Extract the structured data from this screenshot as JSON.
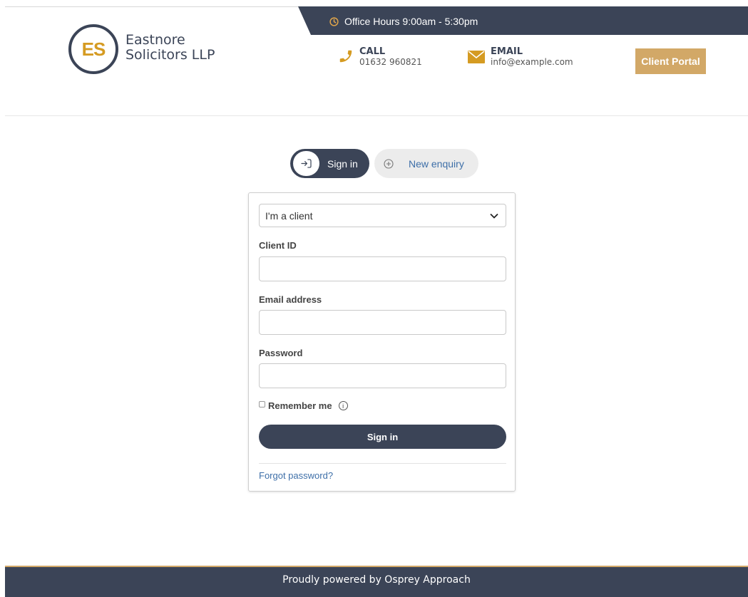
{
  "header": {
    "office_hours": "Office Hours 9:00am - 5:30pm",
    "logo_initials": "ES",
    "logo_name_line1": "Eastnore",
    "logo_name_line2": "Solicitors LLP",
    "call_label": "CALL",
    "call_value": "01632 960821",
    "email_label": "EMAIL",
    "email_value": "info@example.com",
    "portal_button": "Client Portal",
    "icons": [
      "clock-icon",
      "phone-icon",
      "envelope-icon"
    ]
  },
  "tabs": [
    {
      "label": "Sign in",
      "icon": "sign-in-icon",
      "active": true
    },
    {
      "label": "New enquiry",
      "icon": "plus-circle-icon",
      "active": false
    }
  ],
  "form": {
    "account_type": "I'm a client",
    "client_id_label": "Client ID",
    "client_id_value": "",
    "email_label": "Email address",
    "email_value": "",
    "password_label": "Password",
    "password_value": "",
    "remember_label": "Remember me",
    "remember_checked": false,
    "submit_label": "Sign in",
    "forgot_label": "Forgot password?"
  },
  "footer": {
    "text": "Proudly powered by Osprey Approach"
  },
  "colors": {
    "navy": "#3b4457",
    "gold": "#d2a867",
    "logo_gold": "#d59b22",
    "link": "#3e6fa8"
  }
}
